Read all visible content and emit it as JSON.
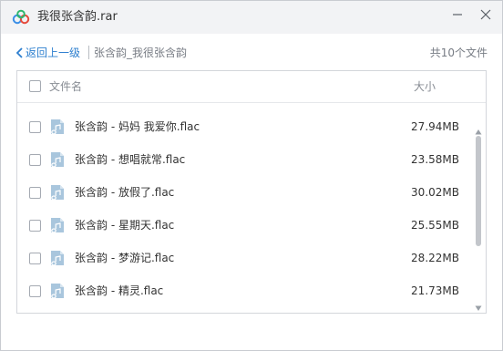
{
  "window": {
    "title": "我很张含韵.rar",
    "icons": {
      "app": "baidu-netdisk-cloud-icon",
      "minimize": "minimize-icon",
      "close": "close-icon"
    }
  },
  "nav": {
    "back_label": "返回上一级",
    "breadcrumb": "张含韵_我很张含韵",
    "file_count": "共10个文件"
  },
  "list": {
    "header": {
      "name": "文件名",
      "size": "大小"
    },
    "files": [
      {
        "name": "张含韵 - 妈妈 我爱你.flac",
        "size": "27.94MB",
        "icon": "audio-file-icon"
      },
      {
        "name": "张含韵 - 想唱就常.flac",
        "size": "23.58MB",
        "icon": "audio-file-icon"
      },
      {
        "name": "张含韵 - 放假了.flac",
        "size": "30.02MB",
        "icon": "audio-file-icon"
      },
      {
        "name": "张含韵 - 星期天.flac",
        "size": "25.55MB",
        "icon": "audio-file-icon"
      },
      {
        "name": "张含韵 - 梦游记.flac",
        "size": "28.22MB",
        "icon": "audio-file-icon"
      },
      {
        "name": "张含韵 - 精灵.flac",
        "size": "21.73MB",
        "icon": "audio-file-icon"
      }
    ]
  },
  "colors": {
    "link": "#2d7fcf",
    "titlebar_bg": "#f2f3f5",
    "text": "#333333",
    "muted": "#888d94"
  }
}
